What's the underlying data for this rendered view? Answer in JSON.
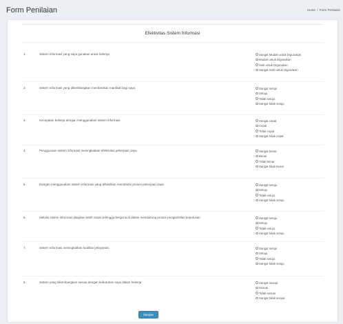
{
  "header": {
    "title": "Form Penilaian",
    "breadcrumb": {
      "home": "Home",
      "separator": "/",
      "current": "Form Penilaian"
    }
  },
  "form": {
    "title": "Efektivitas Sistem Informasi",
    "submit_label": "Simpan",
    "questions": [
      {
        "number": "1.",
        "text": "Sistem informasi yang saya gunakan untuk bekerja",
        "options": [
          "Sangat Mudah untuk Digunakan",
          "Mudah untuk Digunakan",
          "Sulit untuk Digunakan",
          "Sangat Sulit untuk Digunakan"
        ]
      },
      {
        "number": "2.",
        "text": "Sistem informasi yang dikembangkan memberikan manfaat bagi saya.",
        "options": [
          "Sangat setuju",
          "Setuju",
          "Tidak setuju",
          "Sangat tidak setuju"
        ]
      },
      {
        "number": "3.",
        "text": "Kecepatan bekerja dengan menggunakan sistem informasi",
        "options": [
          "Sangat cepat",
          "Cepat",
          "Tidak cepat",
          "Sangat tidak cepat"
        ]
      },
      {
        "number": "4.",
        "text": "Penggunaan sistem informasi meningkatkan efektivitas pekerjaan saya.",
        "options": [
          "Sangat benar",
          "Benar",
          "Tidak benar",
          "Sangat tidak benar"
        ]
      },
      {
        "number": "5.",
        "text": "Dengan menggunakan sistem informasi yang dihasilkan membantu proses pekerjaan saya.",
        "options": [
          "Sangat setuju",
          "Setuju",
          "Tidak setuju",
          "Sangat tidak setuju"
        ]
      },
      {
        "number": "6.",
        "text": "Melalui sistem informasi disajikan lebih cepat sehingga berguna di dalam mendukung proses pengambilan keputusan",
        "options": [
          "Sangat setuju",
          "Setuju",
          "Tidak setuju",
          "Sangat tidak setuju"
        ]
      },
      {
        "number": "7.",
        "text": "Sistem informasi meningkatkan kualitas pelayanan.",
        "options": [
          "Sangat setuju",
          "Setuju",
          "Tidak setuju",
          "Sangat tidak setuju"
        ]
      },
      {
        "number": "8.",
        "text": "Sistem yang dikembangkan sesuai dengan kebutuhan saya dalam bekerja",
        "options": [
          "Sangat sesuai",
          "Sesuai",
          "Tidak sesuai",
          "Sangat tidak sesuai"
        ]
      }
    ]
  }
}
